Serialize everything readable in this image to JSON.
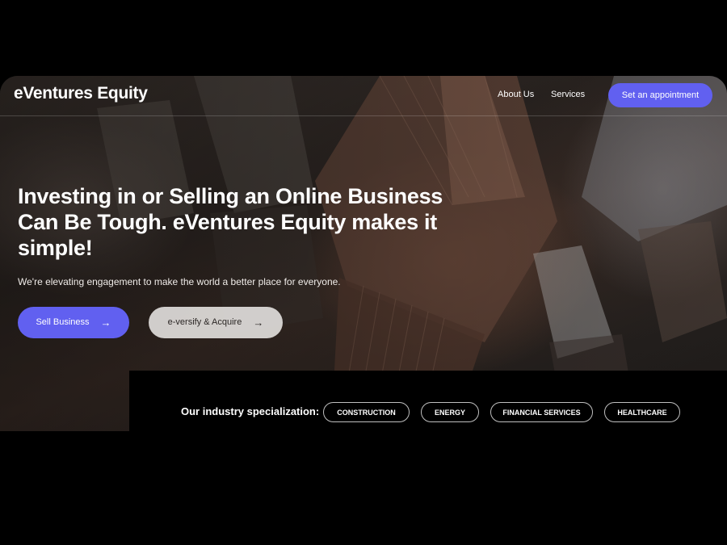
{
  "header": {
    "logo": "eVentures Equity",
    "nav": [
      "About Us",
      "Services"
    ],
    "cta_label": "Set an appointment"
  },
  "hero": {
    "headline": "Investing in or Selling an Online Business Can Be Tough. eVentures Equity makes it simple!",
    "subtext": "We're elevating engagement to make the world a better place for everyone.",
    "primary_button": "Sell Business",
    "secondary_button": "e-versify & Acquire",
    "arrow_icon": "arrow-right-icon"
  },
  "industry": {
    "label": "Our industry specialization:",
    "chips": [
      "CONSTRUCTION",
      "ENERGY",
      "FINANCIAL SERVICES",
      "HEALTHCARE"
    ]
  },
  "colors": {
    "accent": "#6160f0",
    "background": "#000000",
    "secondary_button": "#e8e6e4"
  }
}
